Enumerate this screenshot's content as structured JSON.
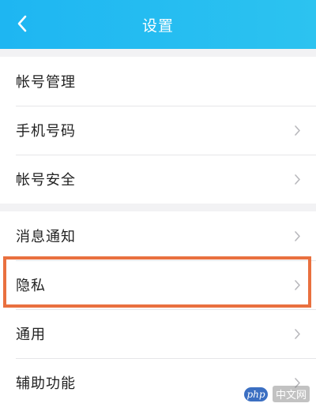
{
  "header": {
    "title": "设置",
    "back_icon": "chevron-left-icon"
  },
  "groups": [
    {
      "items": [
        {
          "label": "帐号管理",
          "has_arrow": false
        },
        {
          "label": "手机号码",
          "has_arrow": true
        },
        {
          "label": "帐号安全",
          "has_arrow": true
        }
      ]
    },
    {
      "items": [
        {
          "label": "消息通知",
          "has_arrow": true
        },
        {
          "label": "隐私",
          "has_arrow": true
        },
        {
          "label": "通用",
          "has_arrow": true
        },
        {
          "label": "辅助功能",
          "has_arrow": true
        }
      ]
    }
  ],
  "highlight_color": "#e9703f",
  "header_color": "#1eb6f2",
  "watermark": {
    "logo": "php",
    "text": "中文网"
  }
}
